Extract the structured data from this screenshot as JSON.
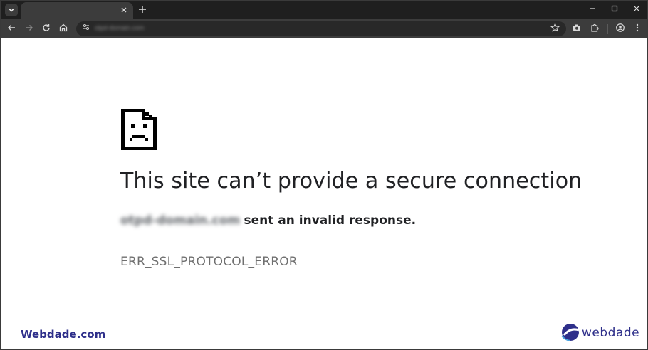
{
  "browser": {
    "tab_search_icon": "chevron-down-icon",
    "tab": {
      "title": "",
      "close_icon": "close-icon"
    },
    "new_tab_icon": "plus-icon",
    "window_controls": [
      "minimize-icon",
      "maximize-icon",
      "close-icon"
    ]
  },
  "toolbar": {
    "icons": [
      "back-arrow-icon",
      "forward-arrow-icon",
      "reload-icon",
      "home-icon"
    ],
    "omnibox": {
      "url": "otpd-domain.com",
      "url_blurred": true,
      "site_info_icon": "tune-icon",
      "bookmark_icon": "star-icon"
    },
    "right_icons": [
      "camera-icon",
      "extensions-icon",
      "profile-icon",
      "more-menu-icon"
    ]
  },
  "error_page": {
    "icon": "sad-document-icon",
    "headline": "This site can’t provide a secure connection",
    "host": "otpd-domain.com",
    "message": "sent an invalid response.",
    "error_code": "ERR_SSL_PROTOCOL_ERROR"
  },
  "watermarks": {
    "left": "Webdade.com",
    "right": "webdade"
  },
  "colors": {
    "tab_strip": "#1f1f1f",
    "toolbar": "#3c3c3c",
    "omnibox": "#282828",
    "headline": "#202124",
    "error_code": "#6f6f6f",
    "watermark": "#2e2f8a"
  }
}
